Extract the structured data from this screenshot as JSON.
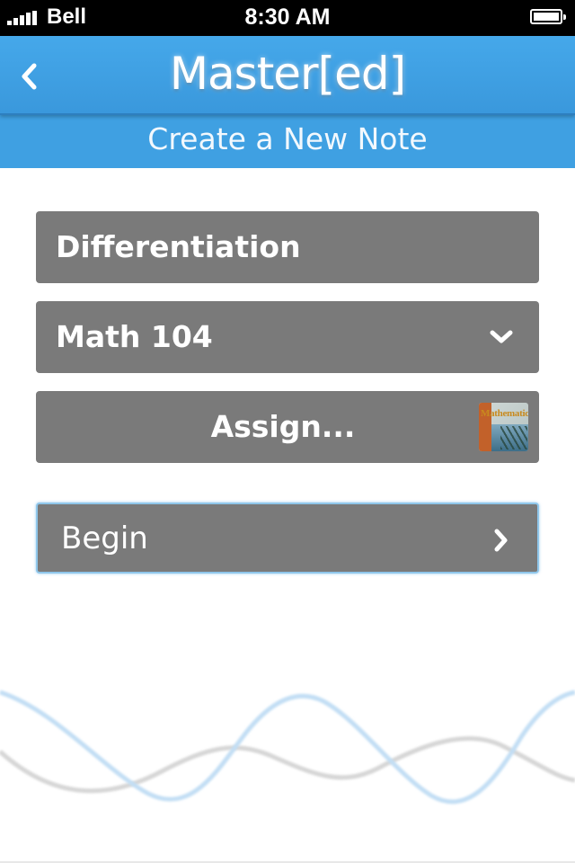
{
  "status_bar": {
    "carrier": "Bell",
    "time": "8:30 AM"
  },
  "nav": {
    "title": "Master[ed]",
    "back_icon": "chevron-left-icon"
  },
  "subheader": {
    "title": "Create a New Note"
  },
  "form": {
    "note_title_value": "Differentiation",
    "subject_value": "Math 104",
    "assign_label": "Assign...",
    "book_thumbnail_title": "Mathematics",
    "begin_label": "Begin"
  },
  "colors": {
    "nav_blue": "#3fa0e2",
    "field_gray": "#7a7a7a",
    "wave_blue": "#bcdcf3",
    "wave_gray": "#d2d2d2"
  }
}
